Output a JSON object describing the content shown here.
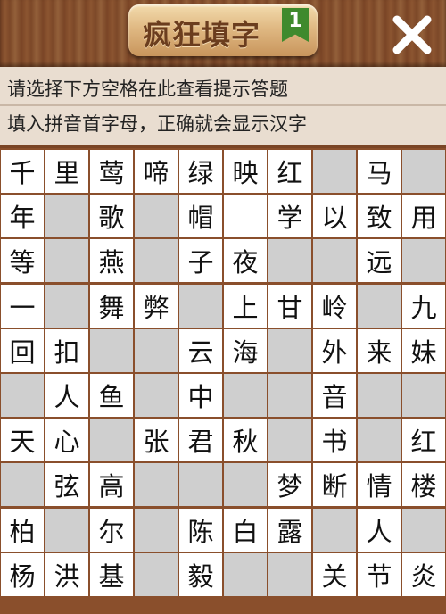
{
  "header": {
    "title": "疯狂填字",
    "level": "1",
    "close_icon": "close-icon"
  },
  "hint": {
    "line1": "请选择下方空格在此查看提示答题",
    "line2": "填入拼音首字母，正确就会显示汉字"
  },
  "colors": {
    "wood": "#8a5634",
    "cell_white": "#ffffff",
    "cell_blank": "#cfcfcf",
    "badge": "#3f8a2d"
  },
  "grid": {
    "rows": [
      [
        "千",
        "里",
        "莺",
        "啼",
        "绿",
        "映",
        "红",
        "#",
        "马",
        "#"
      ],
      [
        "年",
        "#",
        "歌",
        "#",
        "帽",
        "",
        "学",
        "以",
        "致",
        "用"
      ],
      [
        "等",
        "#",
        "燕",
        "#",
        "子",
        "夜",
        "#",
        "#",
        "远",
        "#"
      ],
      [
        "一",
        "#",
        "舞",
        "弊",
        "#",
        "上",
        "甘",
        "岭",
        "#",
        "九"
      ],
      [
        "回",
        "扣",
        "#",
        "#",
        "云",
        "海",
        "#",
        "外",
        "来",
        "妹"
      ],
      [
        "#",
        "人",
        "鱼",
        "#",
        "中",
        "#",
        "#",
        "音",
        "#",
        "#"
      ],
      [
        "天",
        "心",
        "#",
        "张",
        "君",
        "秋",
        "#",
        "书",
        "#",
        "红"
      ],
      [
        "#",
        "弦",
        "高",
        "#",
        "#",
        "#",
        "梦",
        "断",
        "情",
        "楼"
      ],
      [
        "柏",
        "#",
        "尔",
        "#",
        "陈",
        "白",
        "露",
        "#",
        "人",
        "#"
      ],
      [
        "杨",
        "洪",
        "基",
        "#",
        "毅",
        "#",
        "#",
        "关",
        "节",
        "炎"
      ]
    ]
  }
}
